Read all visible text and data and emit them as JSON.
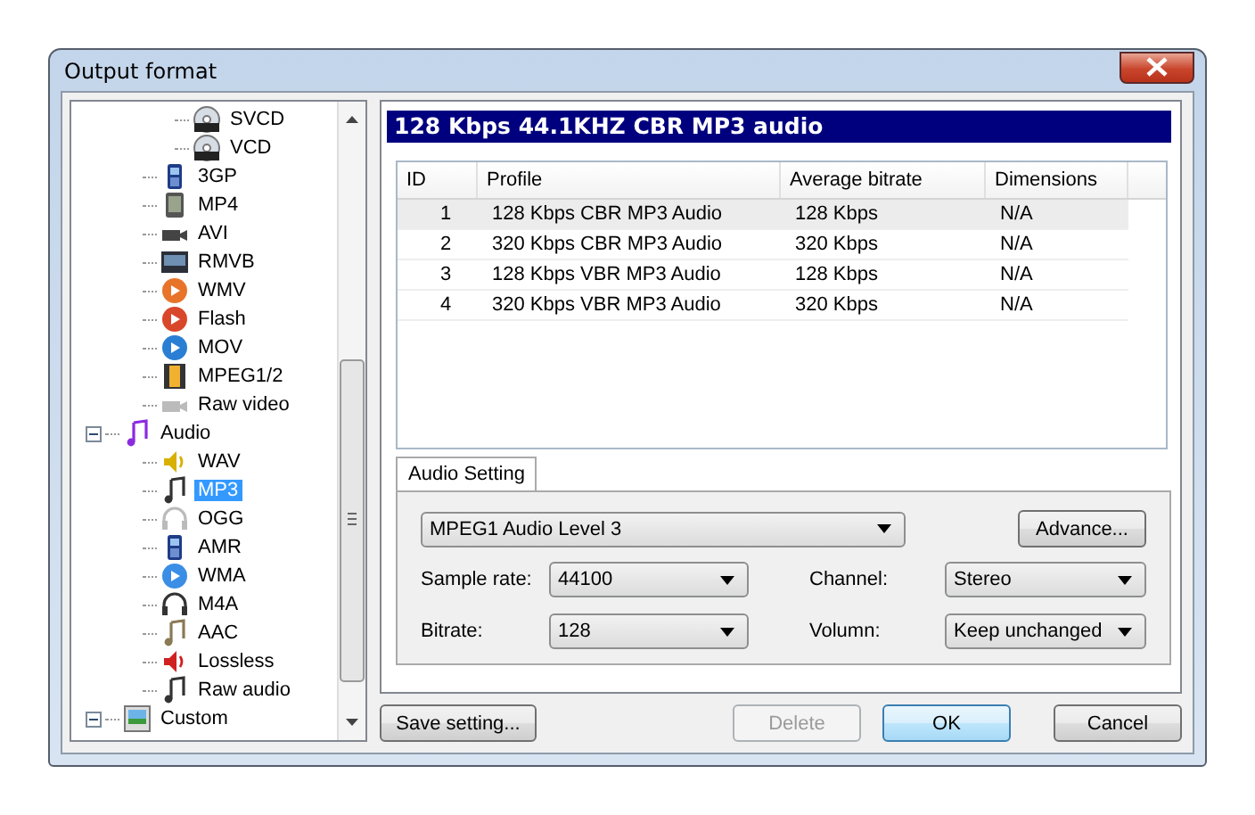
{
  "window": {
    "title": "Output format"
  },
  "tree": {
    "items": [
      {
        "children": [
          {
            "children": [
              {
                "label": "SVCD",
                "selected": false
              },
              {
                "label": "VCD",
                "selected": false
              }
            ]
          },
          {
            "label": "3GP",
            "selected": false
          },
          {
            "label": "MP4",
            "selected": false
          },
          {
            "label": "AVI",
            "selected": false
          },
          {
            "label": "RMVB",
            "selected": false
          },
          {
            "label": "WMV",
            "selected": false
          },
          {
            "label": "Flash",
            "selected": false
          },
          {
            "label": "MOV",
            "selected": false
          },
          {
            "label": "MPEG1/2",
            "selected": false
          },
          {
            "label": "Raw video",
            "selected": false
          }
        ]
      },
      {
        "label": "Audio",
        "selected": false,
        "expanded": true,
        "children": [
          {
            "label": "WAV",
            "selected": false
          },
          {
            "label": "MP3",
            "selected": true
          },
          {
            "label": "OGG",
            "selected": false
          },
          {
            "label": "AMR",
            "selected": false
          },
          {
            "label": "WMA",
            "selected": false
          },
          {
            "label": "M4A",
            "selected": false
          },
          {
            "label": "AAC",
            "selected": false
          },
          {
            "label": "Lossless",
            "selected": false
          },
          {
            "label": "Raw audio",
            "selected": false
          }
        ]
      },
      {
        "label": "Custom",
        "selected": false,
        "expanded": true
      }
    ]
  },
  "profile_title": "128 Kbps 44.1KHZ CBR MP3 audio",
  "table": {
    "columns": [
      "ID",
      "Profile",
      "Average bitrate",
      "Dimensions"
    ],
    "rows": [
      {
        "cells": [
          "1",
          "128 Kbps CBR MP3 Audio",
          "128 Kbps",
          "N/A"
        ],
        "selected": true
      },
      {
        "cells": [
          "2",
          "320 Kbps CBR MP3 Audio",
          "320 Kbps",
          "N/A"
        ],
        "selected": false
      },
      {
        "cells": [
          "3",
          "128 Kbps VBR MP3 Audio",
          "128 Kbps",
          "N/A"
        ],
        "selected": false
      },
      {
        "cells": [
          "4",
          "320 Kbps VBR MP3 Audio",
          "320 Kbps",
          "N/A"
        ],
        "selected": false
      }
    ]
  },
  "settings_tab": {
    "label": "Audio Setting",
    "selected": true
  },
  "codec": {
    "value": "MPEG1 Audio Level 3"
  },
  "advance_button": "Advance...",
  "fields": [
    {
      "label": "Sample rate:",
      "value": "44100"
    },
    {
      "label": "Channel:",
      "value": "Stereo"
    },
    {
      "label": "Bitrate:",
      "value": "128"
    },
    {
      "label": "Volumn:",
      "value": "Keep unchanged"
    }
  ],
  "buttons": [
    {
      "label": "Save setting...",
      "disabled": false,
      "default": false
    },
    {
      "label": "Delete",
      "disabled": true,
      "default": false
    },
    {
      "label": "OK",
      "disabled": false,
      "default": true
    },
    {
      "label": "Cancel",
      "disabled": false,
      "default": false
    }
  ]
}
